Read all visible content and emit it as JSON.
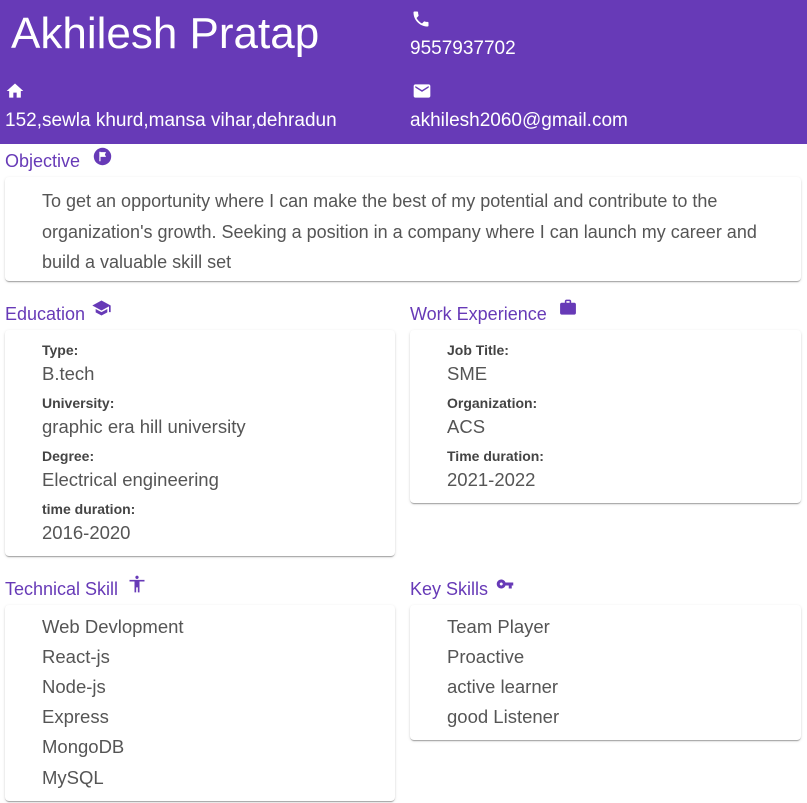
{
  "header": {
    "name": "Akhilesh Pratap",
    "phone": "9557937702",
    "address": "152,sewla khurd,mansa vihar,dehradun",
    "email": "akhilesh2060@gmail.com",
    "background_color": "#673ab7",
    "icons": {
      "phone": "phone-icon",
      "address": "home-icon",
      "email": "email-icon"
    }
  },
  "objective": {
    "title": "Objective",
    "icon": "flag-icon",
    "text": "To get an opportunity where I can make the best of my potential and contribute to the organization's growth. Seeking a position in a company where I can launch my career and build a valuable skill set"
  },
  "education": {
    "title": "Education",
    "icon": "graduation-cap-icon",
    "fields": [
      {
        "label": "Type:",
        "value": "B.tech"
      },
      {
        "label": "University:",
        "value": "graphic era hill university"
      },
      {
        "label": "Degree:",
        "value": "Electrical engineering"
      },
      {
        "label": "time duration:",
        "value": "2016-2020"
      }
    ]
  },
  "work": {
    "title": "Work Experience",
    "icon": "briefcase-icon",
    "fields": [
      {
        "label": "Job Title:",
        "value": "SME"
      },
      {
        "label": "Organization:",
        "value": "ACS"
      },
      {
        "label": "Time duration:",
        "value": "2021-2022"
      }
    ]
  },
  "technical": {
    "title": "Technical Skill",
    "icon": "accessibility-icon",
    "items": [
      "Web Devlopment",
      "React-js",
      "Node-js",
      "Express",
      "MongoDB",
      "MySQL"
    ]
  },
  "key_skills": {
    "title": "Key Skills",
    "icon": "key-icon",
    "items": [
      "Team Player",
      "Proactive",
      "active learner",
      "good Listener"
    ]
  },
  "accent_color": "#673ab7"
}
